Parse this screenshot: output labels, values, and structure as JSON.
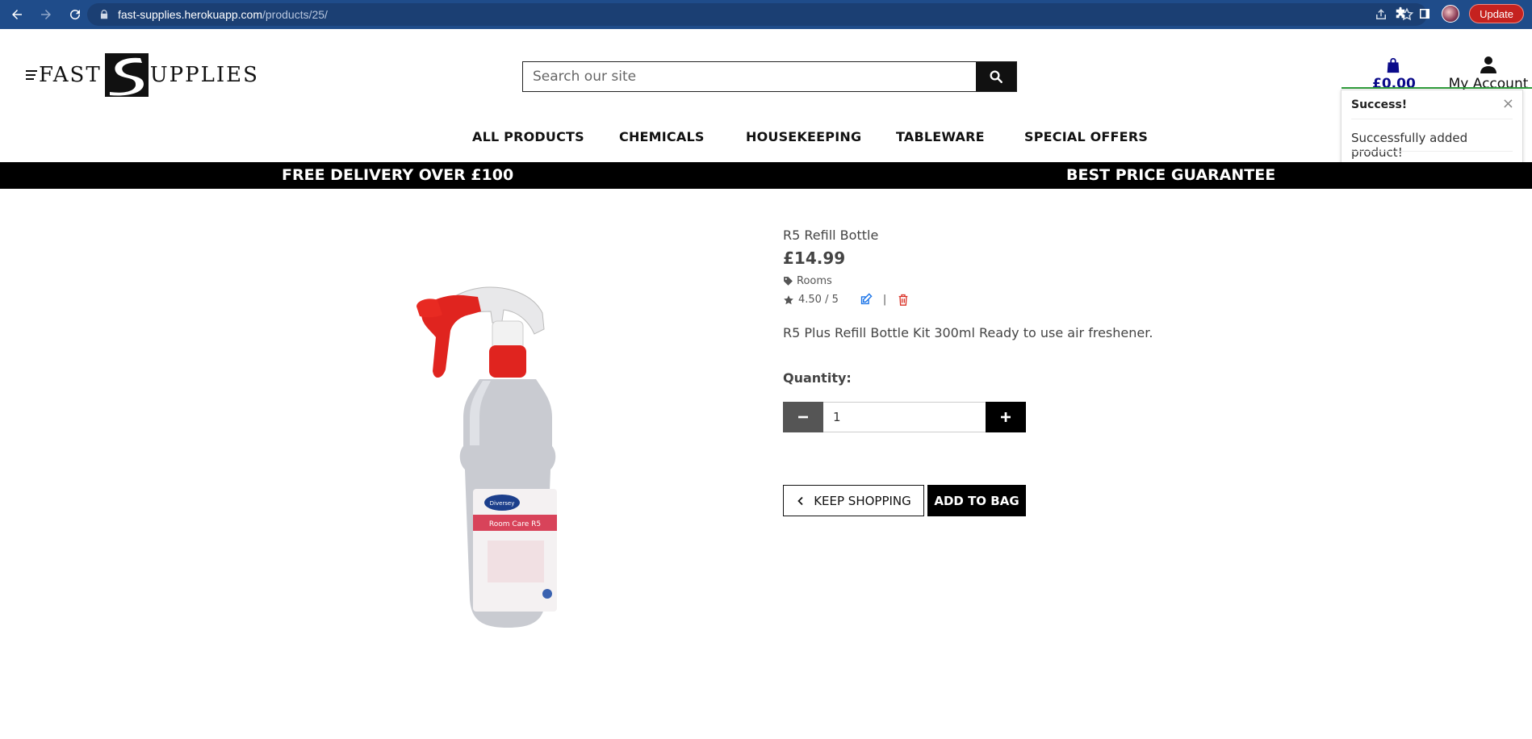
{
  "browser": {
    "url_host": "fast-supplies.herokuapp.com",
    "url_path": "/products/25/",
    "update_label": "Update"
  },
  "header": {
    "logo_left": "FAST",
    "logo_right": "UPPLIES",
    "search_placeholder": "Search our site",
    "bag_total": "£0.00",
    "account_label": "My Account"
  },
  "toast": {
    "title": "Success!",
    "close": "×",
    "message": "Successfully added product!"
  },
  "nav": {
    "items": [
      "ALL PRODUCTS",
      "CHEMICALS",
      "HOUSEKEEPING",
      "TABLEWARE",
      "SPECIAL OFFERS"
    ]
  },
  "banner": {
    "left": "FREE DELIVERY OVER £100",
    "right": "BEST PRICE GUARANTEE"
  },
  "product": {
    "name": "R5 Refill Bottle",
    "price": "£14.99",
    "category": "Rooms",
    "rating": "4.50 / 5",
    "separator": "|",
    "description": "R5 Plus Refill Bottle Kit 300ml Ready to use air freshener.",
    "quantity_label": "Quantity:",
    "quantity_value": "1",
    "bottle_brand": "Diversey",
    "bottle_label": "Room Care R5"
  },
  "actions": {
    "keep_shopping": "KEEP SHOPPING",
    "add_to_bag": "ADD TO BAG"
  },
  "colors": {
    "chrome": "#1f4c8a",
    "banner": "#000000",
    "bag_total": "#0b0b8a",
    "edit_icon": "#1a73e8",
    "delete_icon": "#d93025",
    "toast_line": "#2e9b3a"
  }
}
